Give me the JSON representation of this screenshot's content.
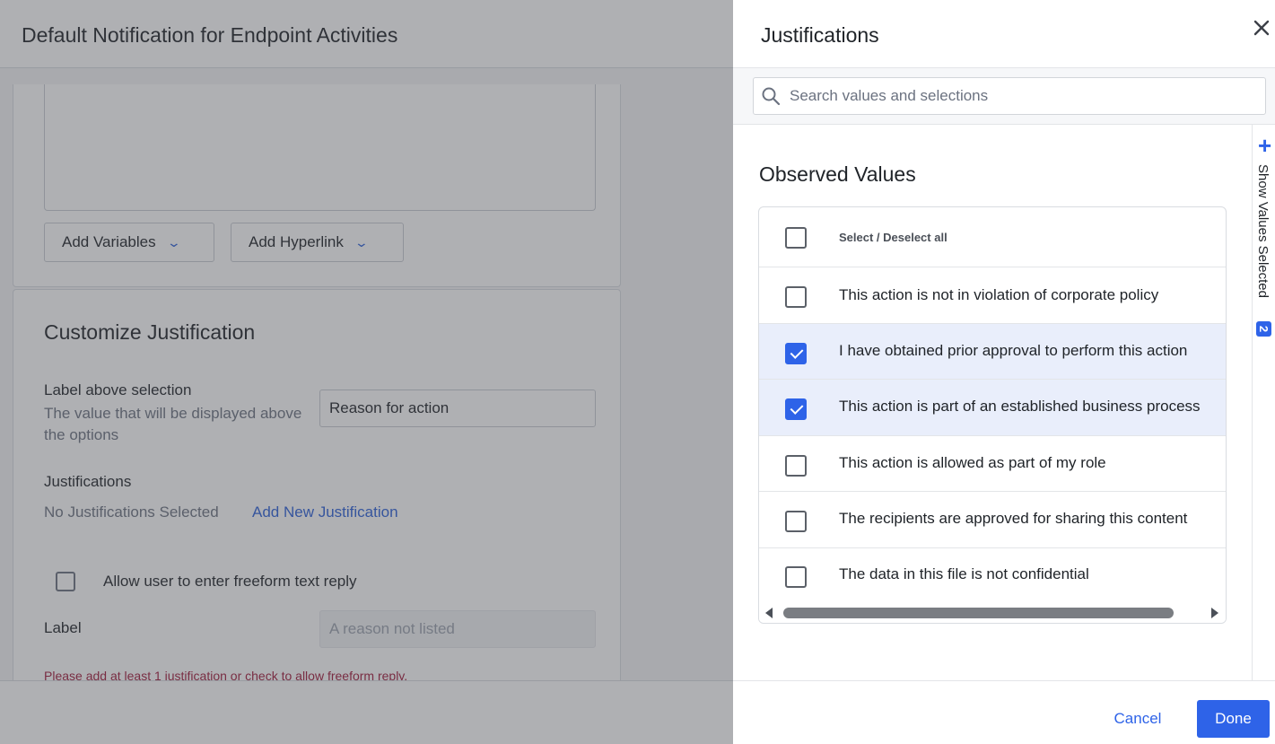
{
  "background": {
    "title": "Default Notification for Endpoint Activities",
    "add_variables_label": "Add Variables",
    "add_hyperlink_label": "Add Hyperlink",
    "customize_title": "Customize Justification",
    "label_above_selection": "Label above selection",
    "label_above_desc": "The value that will be displayed above the options",
    "reason_value": "Reason for action",
    "justifications_heading": "Justifications",
    "no_justifications_text": "No Justifications Selected",
    "add_new_justification": "Add New Justification",
    "allow_freeform_label": "Allow user to enter freeform text reply",
    "label_field_label": "Label",
    "label_field_placeholder": "A reason not listed",
    "error_text": "Please add at least 1 justification or check to allow freeform reply."
  },
  "panel": {
    "title": "Justifications",
    "search_placeholder": "Search values and selections",
    "observed_title": "Observed Values",
    "select_all_label": "Select / Deselect all",
    "rows": [
      {
        "label": "This action is not in violation of corporate policy",
        "checked": false
      },
      {
        "label": "I have obtained prior approval to perform this action",
        "checked": true
      },
      {
        "label": "This action is part of an established business process",
        "checked": true
      },
      {
        "label": "This action is allowed as part of my role",
        "checked": false
      },
      {
        "label": "The recipients are approved for sharing this content",
        "checked": false
      },
      {
        "label": "The data in this file is not confidential",
        "checked": false
      }
    ],
    "side_tab_label": "Show Values Selected",
    "side_tab_count": "2",
    "cancel_label": "Cancel",
    "done_label": "Done"
  },
  "colors": {
    "accent": "#2e63e8",
    "link": "#2b5fd9",
    "error": "#a01a3a",
    "selected_row": "#e9eefb"
  }
}
